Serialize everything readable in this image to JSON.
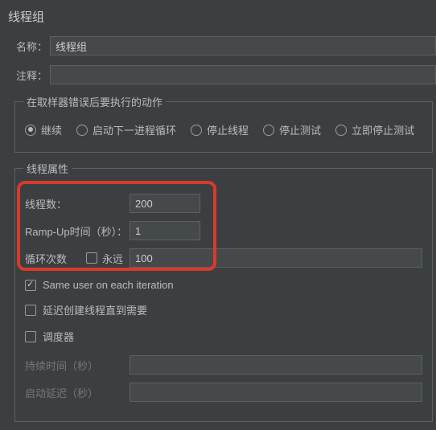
{
  "panel": {
    "title": "线程组"
  },
  "fields": {
    "name_label": "名称：",
    "name_value": "线程组",
    "comment_label": "注释：",
    "comment_value": ""
  },
  "error_group": {
    "legend": "在取样器错误后要执行的动作",
    "options": {
      "continue": "继续",
      "next_loop": "启动下一进程循环",
      "stop_thread": "停止线程",
      "stop_test": "停止测试",
      "stop_now": "立即停止测试"
    }
  },
  "props_group": {
    "legend": "线程属性",
    "threads_label": "线程数：",
    "threads_value": "200",
    "rampup_label": "Ramp-Up时间（秒）：",
    "rampup_value": "1",
    "loop_label": "循环次数",
    "forever_label": "永远",
    "loop_value": "100",
    "same_user": "Same user on each iteration",
    "delay_create": "延迟创建线程直到需要",
    "scheduler": "调度器",
    "duration_label": "持续时间（秒）",
    "delay_label": "启动延迟（秒）"
  }
}
